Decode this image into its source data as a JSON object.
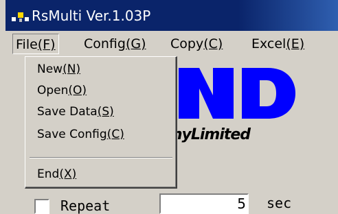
{
  "window": {
    "title": "RsMulti Ver.1.03P",
    "icon": "app-icon"
  },
  "menubar": {
    "items": [
      {
        "label": "File",
        "key": "(F)"
      },
      {
        "label": "Config",
        "key": "(G)"
      },
      {
        "label": "Copy",
        "key": "(C)"
      },
      {
        "label": "Excel",
        "key": "(E)"
      }
    ]
  },
  "file_menu": {
    "items": [
      {
        "label": "New",
        "key": "(N)"
      },
      {
        "label": "Open",
        "key": "(O)"
      },
      {
        "label": "Save Data",
        "key": "(S)"
      },
      {
        "label": "Save Config",
        "key": "(C)"
      },
      {
        "label": "End",
        "key": "(X)"
      }
    ]
  },
  "logo": {
    "company_text": "anyLimited",
    "brand_color": "#0000ff"
  },
  "repeat": {
    "label": "Repeat",
    "checked": false,
    "interval_value": "5",
    "unit": "sec"
  }
}
